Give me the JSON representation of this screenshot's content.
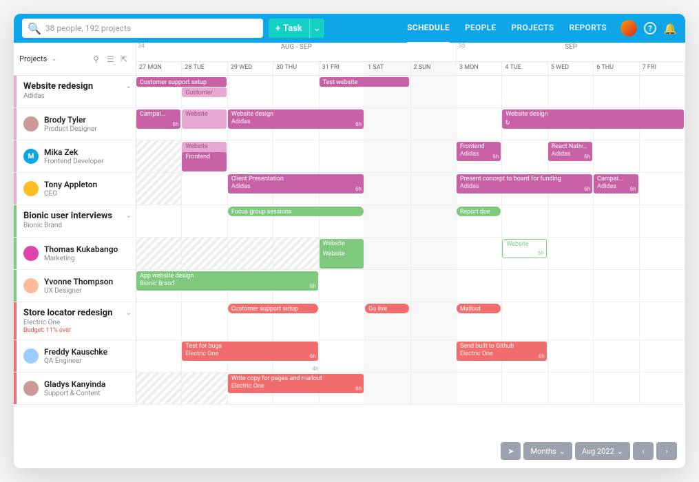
{
  "search": {
    "placeholder": "38 people, 192 projects"
  },
  "task_btn": "Task",
  "nav": {
    "schedule": "SCHEDULE",
    "people": "PEOPLE",
    "projects": "PROJECTS",
    "reports": "REPORTS"
  },
  "side": {
    "label": "Projects"
  },
  "weeks": [
    {
      "num": "34",
      "label": "AUG - SEP"
    },
    {
      "num": "35",
      "label": "SEP"
    }
  ],
  "days": [
    "27 MON",
    "28 TUE",
    "29 WED",
    "30 THU",
    "31 FRI",
    "1 SAT",
    "2 SUN",
    "3 MON",
    "4 TUE",
    "5 WED",
    "6 THU",
    "7 FRI"
  ],
  "footer": {
    "mode": "Months",
    "range": "Aug 2022"
  },
  "projects": [
    {
      "name": "Website redesign",
      "client": "Adidas",
      "stripe": "#e8a8d4",
      "tasks": [
        {
          "row": 0,
          "t": "Customer support setup",
          "c": "pink",
          "s": 0,
          "e": 2,
          "pill": 1
        },
        {
          "row": 1,
          "t": "Customer",
          "c": "pinklight",
          "s": 1,
          "e": 2,
          "pill": 1
        },
        {
          "row": 0,
          "t": "Test website",
          "c": "pink",
          "s": 4,
          "e": 6,
          "pill": 1
        }
      ],
      "people": [
        {
          "name": "Brody Tyler",
          "role": "Product Designer",
          "av": "#c99",
          "tasks": [
            {
              "t": "Campai...",
              "sub": "",
              "c": "pink",
              "s": 0,
              "e": 1,
              "h": "6h"
            },
            {
              "t": "Website",
              "c": "pinklight",
              "s": 1,
              "e": 2
            },
            {
              "t": "Website design",
              "sub": "Adidas",
              "c": "pink",
              "s": 2,
              "e": 5,
              "h": "6h"
            },
            {
              "t": "Website design",
              "sub": "",
              "c": "pink",
              "s": 8,
              "e": 12,
              "h": "",
              "repeat": 1
            }
          ]
        },
        {
          "name": "Mika Zek",
          "role": "Frontend Developer",
          "av": "#0ea5e9",
          "avtxt": "M",
          "tasks": [
            {
              "t": "Website",
              "c": "pinklight",
              "s": 1,
              "e": 2
            },
            {
              "t": "Frontend",
              "c": "pink",
              "s": 1,
              "e": 2,
              "row": 1
            },
            {
              "t": "Frontend",
              "sub": "Adidas",
              "c": "pink",
              "s": 7,
              "e": 8,
              "h": "6h"
            },
            {
              "t": "React Native Assets",
              "sub": "Adidas",
              "c": "pink",
              "s": 9,
              "e": 10,
              "h": "6h"
            }
          ],
          "hatch": [
            0
          ]
        },
        {
          "name": "Tony Appleton",
          "role": "CEO",
          "av": "#fbbf24",
          "tasks": [
            {
              "t": "Client Presentation",
              "sub": "Adidas",
              "c": "pink",
              "s": 2,
              "e": 5,
              "h": "6h"
            },
            {
              "t": "Present concept to board for funding",
              "sub": "Adidas",
              "c": "pink",
              "s": 7,
              "e": 10,
              "h": "6h"
            },
            {
              "t": "Campai...",
              "sub": "Adidas",
              "c": "pink",
              "s": 10,
              "e": 11,
              "h": "6h"
            }
          ],
          "hatch": [
            0
          ]
        }
      ]
    },
    {
      "name": "Bionic user interviews",
      "client": "Bionic Brand",
      "stripe": "#7fc97f",
      "tasks": [
        {
          "row": 0,
          "t": "Focus group sessions",
          "c": "greenpill",
          "s": 2,
          "e": 5,
          "pill": 1
        },
        {
          "row": 0,
          "t": "Report due",
          "c": "greenpill",
          "s": 7,
          "e": 8,
          "pill": 1
        }
      ],
      "people": [
        {
          "name": "Thomas Kukabango",
          "role": "Marketing",
          "av": "#d4a",
          "tasks": [
            {
              "t": "Website",
              "c": "green",
              "s": 4,
              "e": 5
            },
            {
              "t": "Website",
              "c": "green",
              "s": 4,
              "e": 5,
              "row": 1
            },
            {
              "t": "Website",
              "c": "greenout",
              "s": 8,
              "e": 9,
              "h": "6h"
            }
          ],
          "hatch": [
            0,
            1,
            2,
            3
          ]
        },
        {
          "name": "Yvonne Thompson",
          "role": "UX Designer",
          "av": "#fb9",
          "tasks": [
            {
              "t": "App website design",
              "sub": "Bionic Brand",
              "c": "green",
              "s": 0,
              "e": 4,
              "h": "6h"
            }
          ]
        }
      ]
    },
    {
      "name": "Store locator redesign",
      "client": "Electric One",
      "budget": "Budget: 11% over",
      "stripe": "#f16c6c",
      "tasks": [
        {
          "row": 0,
          "t": "Customer support setup",
          "c": "redpill",
          "s": 2,
          "e": 4,
          "pill": 1
        },
        {
          "row": 0,
          "t": "Go live",
          "c": "redpill",
          "s": 5,
          "e": 6,
          "pill": 1
        },
        {
          "row": 0,
          "t": "Mailout",
          "c": "redpill",
          "s": 7,
          "e": 8,
          "pill": 1
        }
      ],
      "people": [
        {
          "name": "Freddy Kauschke",
          "role": "QA Engineer",
          "av": "#9cf",
          "tasks": [
            {
              "t": "Test for bugs",
              "sub": "Electric One",
              "c": "red",
              "s": 1,
              "e": 4,
              "h": "6h"
            },
            {
              "t": "Send built to Github",
              "sub": "Electric One",
              "c": "red",
              "s": 7,
              "e": 9,
              "h": "6h"
            }
          ],
          "foot": "4h"
        },
        {
          "name": "Gladys Kanyinda",
          "role": "Support & Content",
          "av": "#c99",
          "tasks": [
            {
              "t": "Write copy for pages and mailout",
              "sub": "Electric One",
              "c": "red",
              "s": 2,
              "e": 5,
              "h": "6h"
            }
          ],
          "hatch": [
            0,
            1
          ]
        }
      ]
    }
  ]
}
